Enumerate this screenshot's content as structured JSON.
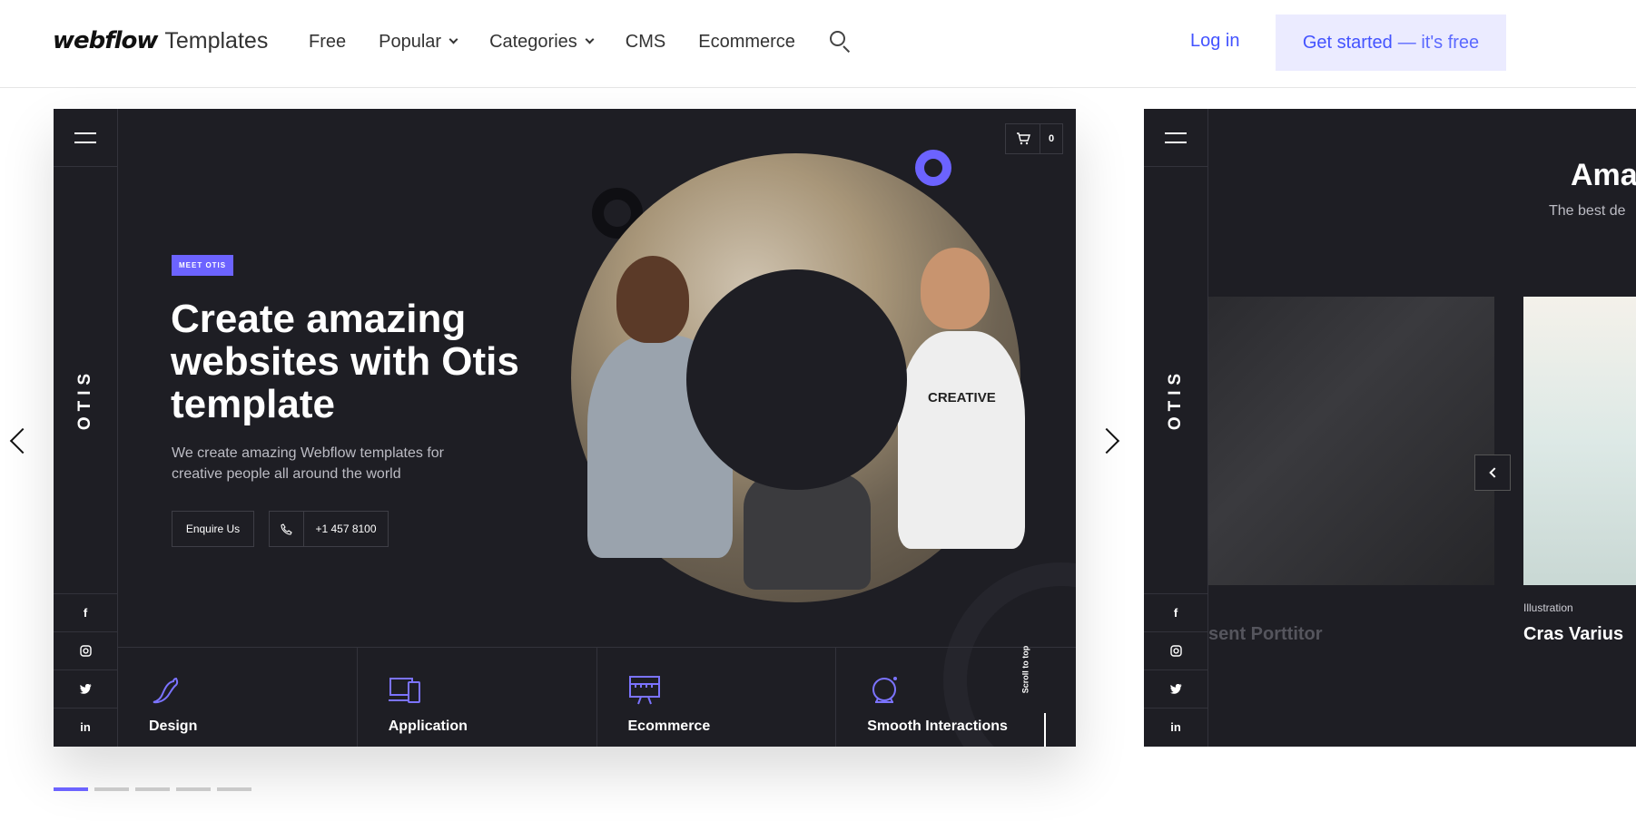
{
  "header": {
    "logo_brand": "webflow",
    "logo_sub": "Templates",
    "nav": [
      {
        "label": "Free"
      },
      {
        "label": "Popular"
      },
      {
        "label": "Categories"
      },
      {
        "label": "CMS"
      },
      {
        "label": "Ecommerce"
      }
    ],
    "login_label": "Log in",
    "cta_label": "Get started",
    "cta_suffix": "— it's free"
  },
  "slide1": {
    "rail_brand": "OTIS",
    "socials": [
      "f",
      "◎",
      "🐦",
      "in"
    ],
    "cart_count": "0",
    "badge": "MEET OTIS",
    "title": "Create amazing websites with Otis template",
    "subtitle": "We create amazing Webflow templates for creative people all around the world",
    "enquire_label": "Enquire Us",
    "phone": "+1 457 8100",
    "shirt_text": "CREATIVE",
    "features": [
      {
        "label": "Design",
        "icon": "pepper-icon"
      },
      {
        "label": "Application",
        "icon": "devices-icon"
      },
      {
        "label": "Ecommerce",
        "icon": "storefront-icon"
      },
      {
        "label": "Smooth Interactions",
        "icon": "crystal-ball-icon"
      }
    ],
    "scroll_label": "Scroll to top"
  },
  "slide2": {
    "rail_brand": "OTIS",
    "title": "Ama",
    "subtitle": "The best de",
    "caption_left": "sent Porttitor",
    "category": "Illustration",
    "caption_right": "Cras Varius"
  },
  "pagination": {
    "count": 5,
    "active_index": 0
  },
  "colors": {
    "accent": "#6c63ff",
    "brand_blue": "#4353ff",
    "slide_bg": "#1e1e24"
  }
}
